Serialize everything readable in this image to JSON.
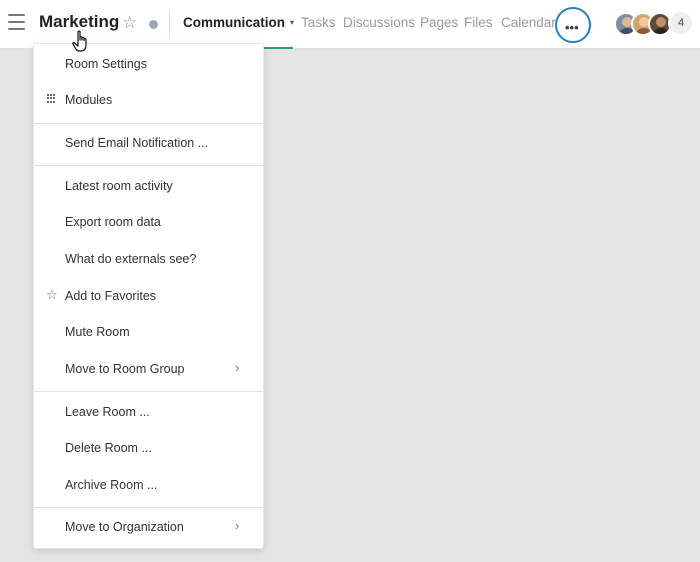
{
  "header": {
    "room_title": "Marketing",
    "tabs": [
      {
        "label": "Communication",
        "active": true
      },
      {
        "label": "Tasks"
      },
      {
        "label": "Discussions"
      },
      {
        "label": "Pages"
      },
      {
        "label": "Files"
      },
      {
        "label": "Calendar"
      }
    ],
    "tab_caret": "▾",
    "more_label": "•••",
    "member_count": "4",
    "accent_color": "#2c9c7e",
    "focus_ring_color": "#2a7fb7"
  },
  "menu": {
    "items": [
      {
        "label": "Room Settings"
      },
      {
        "label": "Modules",
        "icon": "grid-icon"
      },
      {
        "label": "Send Email Notification ..."
      },
      {
        "label": "Latest room activity"
      },
      {
        "label": "Export room data"
      },
      {
        "label": "What do externals see?"
      },
      {
        "label": "Add to Favorites",
        "icon": "star-outline-icon"
      },
      {
        "label": "Mute Room"
      },
      {
        "label": "Move to Room Group",
        "submenu": true
      },
      {
        "label": "Leave Room ..."
      },
      {
        "label": "Delete Room ..."
      },
      {
        "label": "Archive Room ..."
      },
      {
        "label": "Move to Organization",
        "submenu": true
      }
    ],
    "chevron": "›"
  }
}
